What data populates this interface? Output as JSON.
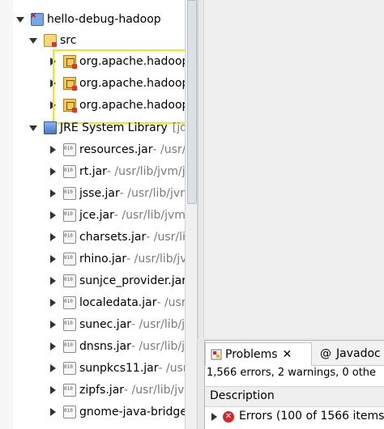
{
  "explorer": {
    "project": {
      "label": "hello-debug-hadoop"
    },
    "src": {
      "label": "src"
    },
    "packages": [
      {
        "label": "org.apache.hadoop"
      },
      {
        "label": "org.apache.hadoop"
      },
      {
        "label": "org.apache.hadoop"
      }
    ],
    "jre": {
      "label": "JRE System Library",
      "suffix": "[jdk"
    },
    "jars": [
      {
        "label": "resources.jar",
        "path": " - /usr/lib/jvm"
      },
      {
        "label": "rt.jar",
        "path": " - /usr/lib/jvm/j"
      },
      {
        "label": "jsse.jar",
        "path": " - /usr/lib/jvm/"
      },
      {
        "label": "jce.jar",
        "path": " - /usr/lib/jvm/"
      },
      {
        "label": "charsets.jar",
        "path": " - /usr/lib/jv"
      },
      {
        "label": "rhino.jar",
        "path": " - /usr/lib/jvm"
      },
      {
        "label": "sunjce_provider.jar",
        "path": ""
      },
      {
        "label": "localedata.jar",
        "path": " - /usr/lib/"
      },
      {
        "label": "sunec.jar",
        "path": " - /usr/lib/jvm"
      },
      {
        "label": "dnsns.jar",
        "path": " - /usr/lib/jvm"
      },
      {
        "label": "sunpkcs11.jar",
        "path": " - /usr/lib/"
      },
      {
        "label": "zipfs.jar",
        "path": " - /usr/lib/jvm"
      },
      {
        "label": "gnome-java-bridge",
        "path": ""
      }
    ]
  },
  "problems": {
    "tab_label": "Problems",
    "javadoc_label": "Javadoc",
    "summary": "1,566 errors, 2 warnings, 0 othe",
    "column_header": "Description",
    "error_row": "Errors (100 of 1566 items"
  },
  "colors": {
    "highlight_border": "#e7ea1a",
    "error": "#d62828"
  }
}
